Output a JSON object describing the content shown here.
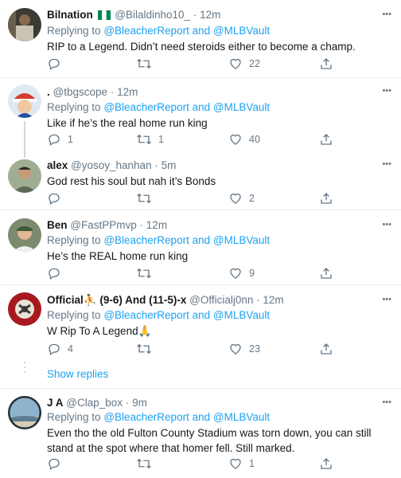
{
  "colors": {
    "link": "#1da1f2",
    "muted": "#657786",
    "text": "#14171a"
  },
  "tweets": [
    {
      "name": "Bilnation",
      "handle": "@Bilaldinho10_",
      "time": "12m",
      "reply_prefix": "Replying to",
      "reply_users": [
        "@BleacherReport",
        "@MLBVault"
      ],
      "reply_and": "and",
      "text": "RIP to a Legend. Didn’t need steroids either to become a champ.",
      "replies": "",
      "retweets": "",
      "likes": "22"
    },
    {
      "name": ".",
      "handle": "@tbgscope",
      "time": "12m",
      "reply_prefix": "Replying to",
      "reply_users": [
        "@BleacherReport",
        "@MLBVault"
      ],
      "reply_and": "and",
      "text": "Like if he’s the real home run king",
      "replies": "1",
      "retweets": "1",
      "likes": "40"
    },
    {
      "name": "alex",
      "handle": "@yosoy_hanhan",
      "time": "5m",
      "text": "God rest his soul but nah it’s Bonds",
      "replies": "",
      "retweets": "",
      "likes": "2"
    },
    {
      "name": "Ben",
      "handle": "@FastPPmvp",
      "time": "12m",
      "reply_prefix": "Replying to",
      "reply_users": [
        "@BleacherReport",
        "@MLBVault"
      ],
      "reply_and": "and",
      "text": "He’s the REAL home run king",
      "replies": "",
      "retweets": "",
      "likes": "9"
    },
    {
      "name": "Official",
      "name_emoji": "⛹",
      "name_rest": "(9-6) And (11-5)-x",
      "handle": "@Officialj0nn",
      "time": "12m",
      "reply_prefix": "Replying to",
      "reply_users": [
        "@BleacherReport",
        "@MLBVault"
      ],
      "reply_and": "and",
      "text": "W Rip To A Legend",
      "text_emoji": "🙏",
      "replies": "4",
      "retweets": "",
      "likes": "23"
    },
    {
      "name": "J A",
      "handle": "@Clap_box",
      "time": "9m",
      "reply_prefix": "Replying to",
      "reply_users": [
        "@BleacherReport",
        "@MLBVault"
      ],
      "reply_and": "and",
      "text": "Even tho the old Fulton County Stadium was torn down, you can still stand at the spot where that homer fell. Still marked.",
      "replies": "",
      "retweets": "",
      "likes": "1"
    }
  ],
  "show_replies": "Show replies"
}
